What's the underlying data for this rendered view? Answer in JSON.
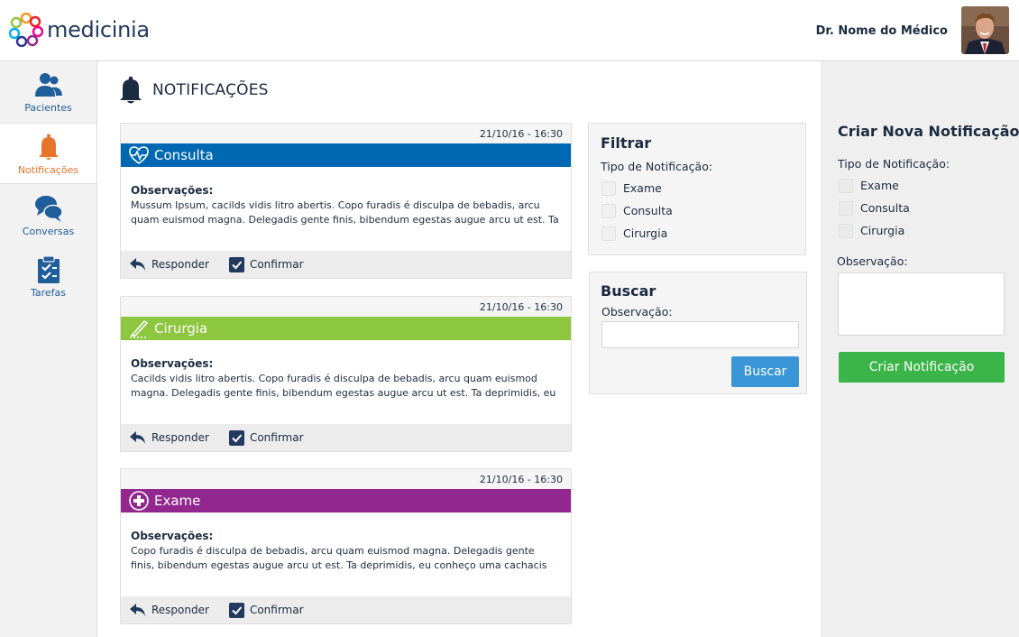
{
  "header": {
    "brand": "medicinia",
    "doctor_name": "Dr. Nome do Médico"
  },
  "sidebar": {
    "items": [
      {
        "label": "Pacientes",
        "icon": "patients-icon"
      },
      {
        "label": "Notificações",
        "icon": "bell-icon",
        "active": true
      },
      {
        "label": "Conversas",
        "icon": "chat-icon"
      },
      {
        "label": "Tarefas",
        "icon": "clipboard-icon"
      }
    ]
  },
  "page": {
    "title": "NOTIFICAÇÕES"
  },
  "notifications": [
    {
      "timestamp": "21/10/16 - 16:30",
      "type": "Consulta",
      "color": "#0068b2",
      "icon": "heart-pulse-icon",
      "obs_title": "Observações:",
      "obs_text": "Mussum Ipsum, cacilds vidis litro abertis. Copo furadis é disculpa de bebadis, arcu quam euismod magna. Delegadis gente finis, bibendum egestas augue arcu ut est. Ta",
      "reply_label": "Responder",
      "confirm_label": "Confirmar"
    },
    {
      "timestamp": "21/10/16 - 16:30",
      "type": "Cirurgia",
      "color": "#8dc63f",
      "icon": "scalpel-icon",
      "obs_title": "Observações:",
      "obs_text": "Cacilds vidis litro abertis. Copo furadis é disculpa de bebadis, arcu quam euismod magna. Delegadis gente finis, bibendum egestas augue arcu ut est. Ta deprimidis, eu",
      "reply_label": "Responder",
      "confirm_label": "Confirmar"
    },
    {
      "timestamp": "21/10/16 - 16:30",
      "type": "Exame",
      "color": "#92278f",
      "icon": "medical-cross-icon",
      "obs_title": "Observações:",
      "obs_text": "Copo furadis é disculpa de bebadis, arcu quam euismod magna. Delegadis gente finis, bibendum egestas augue arcu ut est. Ta deprimidis, eu conheço uma cachacis que",
      "reply_label": "Responder",
      "confirm_label": "Confirmar"
    }
  ],
  "filter": {
    "title": "Filtrar",
    "type_label": "Tipo de Notificação:",
    "options": [
      "Exame",
      "Consulta",
      "Cirurgia"
    ]
  },
  "search": {
    "title": "Buscar",
    "obs_label": "Observação:",
    "input_value": "",
    "button_label": "Buscar"
  },
  "create": {
    "title": "Criar Nova Notificação",
    "type_label": "Tipo de Notificação:",
    "options": [
      "Exame",
      "Consulta",
      "Cirurgia"
    ],
    "obs_label": "Observação:",
    "textarea_value": "",
    "button_label": "Criar Notificação"
  },
  "colors": {
    "accent_blue": "#3a96d6",
    "create_green": "#3bb54a",
    "active_orange": "#e7742a",
    "navy": "#1c2b40"
  }
}
